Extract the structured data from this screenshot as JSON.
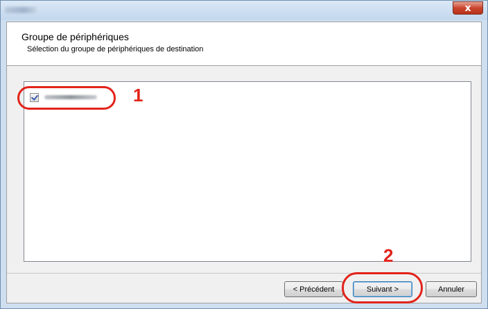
{
  "window": {
    "close_glyph": "x",
    "close_color": "#c9452f"
  },
  "header": {
    "title": "Groupe de périphériques",
    "subtitle": "Sélection du groupe de périphériques de destination"
  },
  "device_list": {
    "items": [
      {
        "checked": true
      }
    ]
  },
  "annotations": {
    "step1": "1",
    "step2": "2",
    "color": "#e2231a"
  },
  "buttons": {
    "back": "< Précédent",
    "next": "Suivant >",
    "cancel": "Annuler"
  }
}
